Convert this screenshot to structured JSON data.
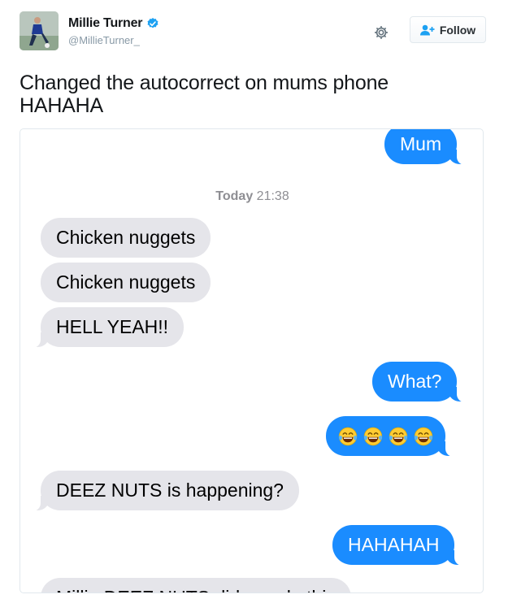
{
  "author": {
    "name": "Millie Turner",
    "handle": "@MillieTurner_",
    "verified": true
  },
  "actions": {
    "follow_label": "Follow"
  },
  "tweet": {
    "text": "Changed the autocorrect on mums phone HAHAHA"
  },
  "conversation": {
    "contact_bubble": "Mum",
    "timestamp_day": "Today",
    "timestamp_time": "21:38",
    "messages": [
      {
        "from": "them",
        "text": "Chicken nuggets"
      },
      {
        "from": "them",
        "text": "Chicken nuggets"
      },
      {
        "from": "them",
        "text": "HELL YEAH!!"
      },
      {
        "from": "me",
        "text": "What?"
      },
      {
        "from": "me",
        "emoji": "face-with-tears-of-joy",
        "count": 4
      },
      {
        "from": "them",
        "text": "DEEZ NUTS is happening?"
      },
      {
        "from": "me",
        "text": "HAHAHAH"
      },
      {
        "from": "them",
        "text": "Millie DEEZ NUTS did you do this"
      }
    ]
  },
  "colors": {
    "outgoing_bubble": "#1a8cff",
    "incoming_bubble": "#e5e5ea",
    "verified_badge": "#1da1f2"
  },
  "icons": [
    "verified-badge-icon",
    "gear-icon",
    "follow-user-icon",
    "face-with-tears-of-joy-icon"
  ]
}
